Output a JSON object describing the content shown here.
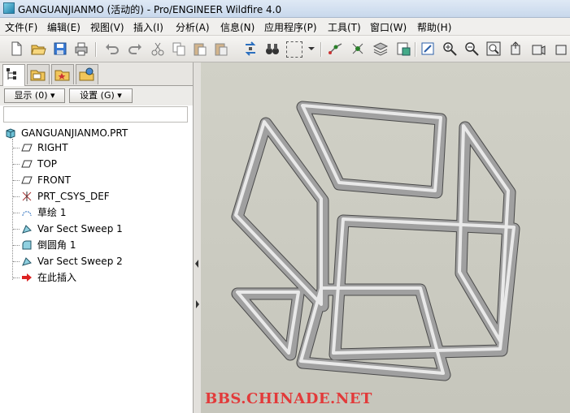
{
  "window": {
    "title": "GANGUANJIANMO (活动的) - Pro/ENGINEER Wildfire 4.0"
  },
  "menu": [
    "文件(F)",
    "编辑(E)",
    "视图(V)",
    "插入(I)",
    "分析(A)",
    "信息(N)",
    "应用程序(P)",
    "工具(T)",
    "窗口(W)",
    "帮助(H)"
  ],
  "filter": {
    "show_label": "显示 (0)",
    "settings_label": "设置 (G)"
  },
  "tree": {
    "root": "GANGUANJIANMO.PRT",
    "items": [
      "RIGHT",
      "TOP",
      "FRONT",
      "PRT_CSYS_DEF",
      "草绘 1",
      "Var Sect Sweep 1",
      "倒圆角 1",
      "Var Sect Sweep 2",
      "在此插入"
    ]
  },
  "watermark": "BBS.CHINADE.NET",
  "colors": {
    "accent_red": "#e23a3a",
    "viewport_bg": "#cbcbc1",
    "tube": "#9a9a9a"
  }
}
